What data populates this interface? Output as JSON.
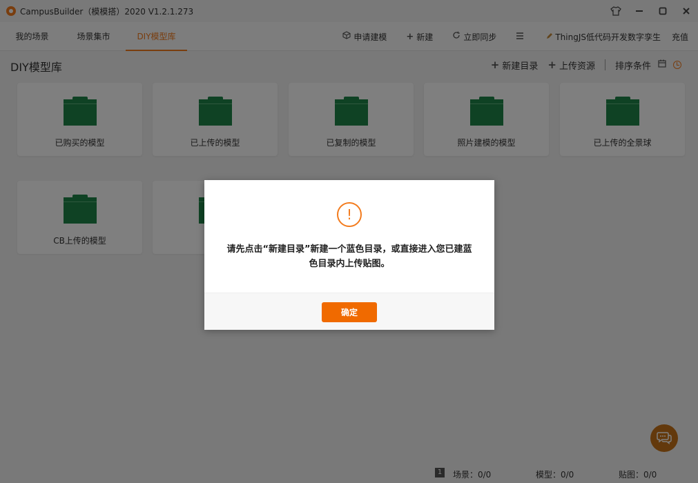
{
  "window": {
    "title": "CampusBuilder（模模搭）2020  V1.2.1.273",
    "controls": [
      "shirt-icon",
      "minimize-icon",
      "maximize-icon",
      "close-icon"
    ]
  },
  "nav": {
    "tabs": [
      {
        "label": "我的场景",
        "active": false
      },
      {
        "label": "场景集市",
        "active": false
      },
      {
        "label": "DIY模型库",
        "active": true
      }
    ],
    "actions": {
      "apply_model": "申请建模",
      "new": "新建",
      "sync": "立即同步",
      "user": "ThingJS低代码开发数字孪生",
      "recharge": "充值"
    }
  },
  "page": {
    "title": "DIY模型库",
    "tools": {
      "new_dir": "新建目录",
      "upload": "上传资源",
      "sort": "排序条件"
    }
  },
  "folders": [
    {
      "label": "已购买的模型"
    },
    {
      "label": "已上传的模型"
    },
    {
      "label": "已复制的模型"
    },
    {
      "label": "照片建模的模型"
    },
    {
      "label": "已上传的全景球"
    },
    {
      "label": "CB上传的模型"
    },
    {
      "label": ""
    }
  ],
  "dialog": {
    "message_line1": "请先点击“新建目录”新建一个蓝色目录，或直接进入您已建蓝",
    "message_line2": "色目录内上传贴图。",
    "ok": "确定"
  },
  "status": {
    "page_badge": "1",
    "scenes": "场景：0/0",
    "models": "模型：0/0",
    "textures": "贴图：0/0"
  },
  "colors": {
    "accent": "#f37b1d",
    "folder": "#1e8449",
    "button": "#f06a00"
  }
}
